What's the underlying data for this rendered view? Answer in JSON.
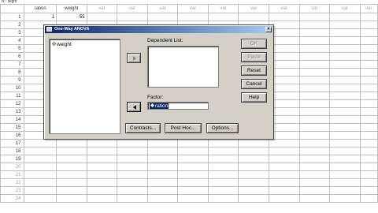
{
  "top_line_text": "N : Night",
  "sheet": {
    "columns": [
      "ration",
      "weight",
      "var",
      "var",
      "var",
      "var",
      "var",
      "var",
      "var",
      "var",
      "var",
      "var"
    ],
    "row_numbers": [
      "1",
      "2",
      "3",
      "4",
      "5",
      "6",
      "7",
      "8",
      "9",
      "10",
      "11",
      "12",
      "13",
      "14",
      "15",
      "16",
      "17",
      "18",
      "19",
      "20",
      "21",
      "22",
      "23",
      "24"
    ],
    "row1": {
      "ration": "1",
      "weight": "55"
    }
  },
  "dialog": {
    "title": "One-Way ANOVA",
    "close_glyph": "×",
    "source_variables": [
      {
        "name": "weight",
        "icon": "scale-variable-icon"
      }
    ],
    "dependent_list_label": "Dependent List:",
    "factor_label": "Factor:",
    "factor_value": "ration",
    "buttons": {
      "ok": "OK",
      "paste": "Paste",
      "reset": "Reset",
      "cancel": "Cancel",
      "help": "Help",
      "contrasts": "Contrasts...",
      "post_hoc": "Post Hoc...",
      "options": "Options..."
    }
  },
  "colors": {
    "title_bar_start": "#0a246a",
    "title_bar_end": "#a6caf0",
    "dialog_face": "#d4d0c8",
    "selection": "#0a246a"
  }
}
